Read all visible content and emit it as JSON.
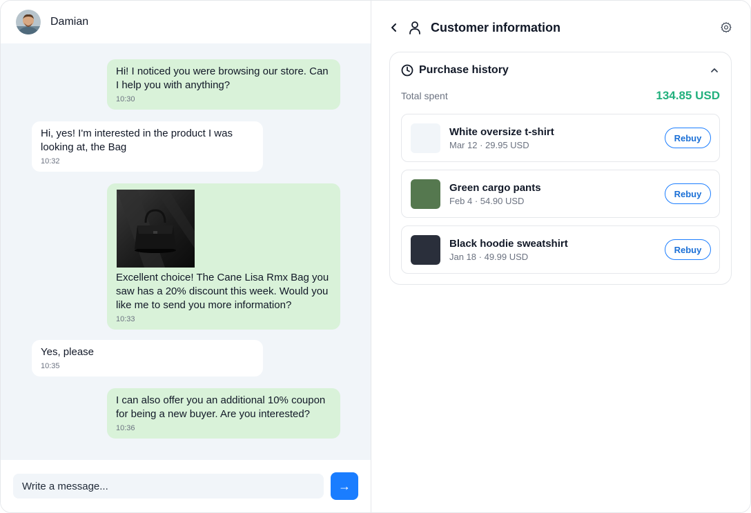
{
  "contact": {
    "name": "Damian"
  },
  "messages": [
    {
      "direction": "out",
      "text": "Hi! I noticed you were browsing our store. Can I help you with anything?",
      "time": "10:30"
    },
    {
      "direction": "in",
      "text": "Hi, yes! I'm interested in the product I was looking at, the Bag",
      "time": "10:32"
    },
    {
      "direction": "out",
      "text": "Excellent choice! The Cane Lisa Rmx Bag you saw has a 20% discount this week. Would you like me to send you more information?",
      "time": "10:33",
      "has_image": true
    },
    {
      "direction": "in",
      "text": "Yes, please",
      "time": "10:35"
    },
    {
      "direction": "out",
      "text": "I can also offer you an additional 10% coupon for being a new buyer. Are you interested?",
      "time": "10:36"
    }
  ],
  "composer": {
    "placeholder": "Write a message...",
    "send_icon": "→"
  },
  "customer_panel": {
    "title": "Customer information",
    "purchase_history": {
      "title": "Purchase history",
      "total_label": "Total spent",
      "total_value": "134.85 USD",
      "items": [
        {
          "name": "White oversize t-shirt",
          "meta": "Mar 12 · 29.95 USD",
          "thumb_color": "#f1f5f9",
          "action": "Rebuy"
        },
        {
          "name": "Green cargo pants",
          "meta": "Feb 4 · 54.90 USD",
          "thumb_color": "#55784f",
          "action": "Rebuy"
        },
        {
          "name": "Black hoodie sweatshirt",
          "meta": "Jan 18 · 49.99 USD",
          "thumb_color": "#2a2f3b",
          "action": "Rebuy"
        }
      ]
    }
  },
  "colors": {
    "accent": "#1a7dff",
    "outgoing_bubble": "#d9f2d9",
    "incoming_bubble": "#ffffff",
    "chat_background": "#f1f5f9",
    "total_value": "#22b07d"
  }
}
